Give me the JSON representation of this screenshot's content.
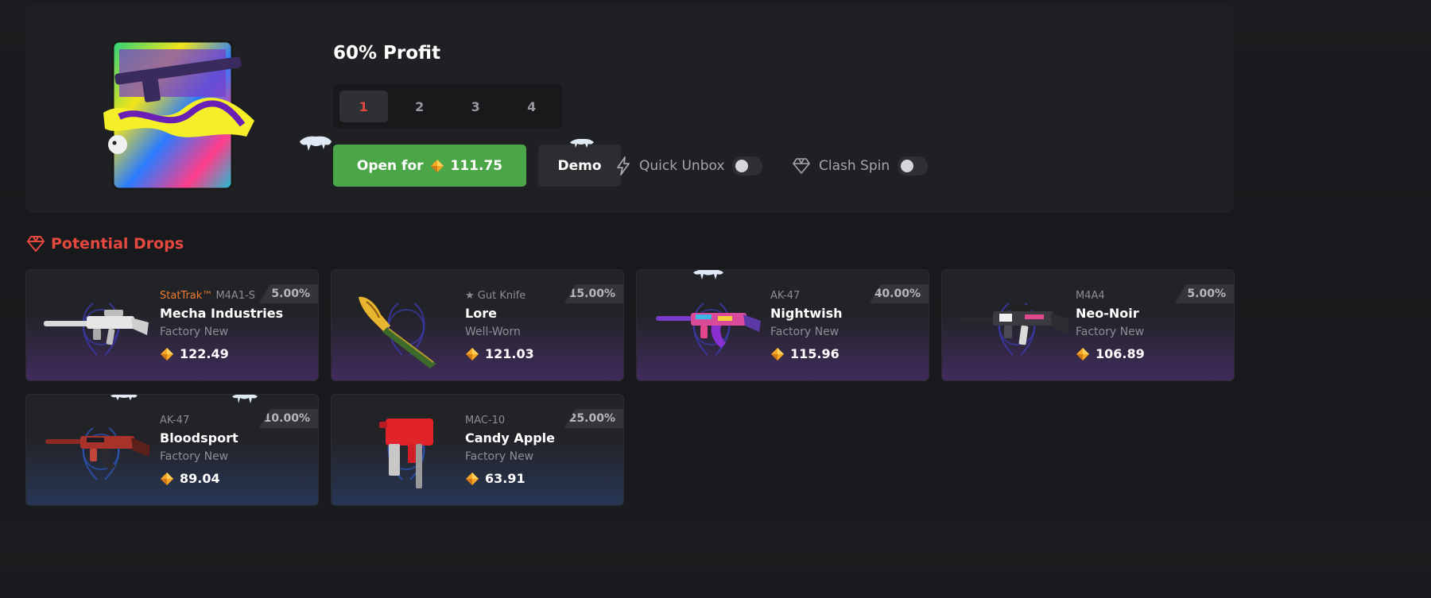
{
  "case": {
    "title": "60% Profit",
    "counts": [
      "1",
      "2",
      "3",
      "4"
    ],
    "selected_count": "1",
    "open_label": "Open for",
    "open_price": "111.75",
    "demo_label": "Demo"
  },
  "toggles": {
    "quick_unbox": {
      "label": "Quick Unbox",
      "enabled": false
    },
    "clash_spin": {
      "label": "Clash Spin",
      "enabled": false
    }
  },
  "drops_section": {
    "title": "Potential Drops"
  },
  "drops": [
    {
      "stattrak": "StatTrak™",
      "weapon": "M4A1-S",
      "name": "Mecha Industries",
      "condition": "Factory New",
      "price": "122.49",
      "chance": "5.00%",
      "rarity_color": "purple"
    },
    {
      "stattrak": "",
      "weapon": "★ Gut Knife",
      "name": "Lore",
      "condition": "Well-Worn",
      "price": "121.03",
      "chance": "15.00%",
      "rarity_color": "purple"
    },
    {
      "stattrak": "",
      "weapon": "AK-47",
      "name": "Nightwish",
      "condition": "Factory New",
      "price": "115.96",
      "chance": "40.00%",
      "rarity_color": "purple"
    },
    {
      "stattrak": "",
      "weapon": "M4A4",
      "name": "Neo-Noir",
      "condition": "Factory New",
      "price": "106.89",
      "chance": "5.00%",
      "rarity_color": "purple"
    },
    {
      "stattrak": "",
      "weapon": "AK-47",
      "name": "Bloodsport",
      "condition": "Factory New",
      "price": "89.04",
      "chance": "10.00%",
      "rarity_color": "blue"
    },
    {
      "stattrak": "",
      "weapon": "MAC-10",
      "name": "Candy Apple",
      "condition": "Factory New",
      "price": "63.91",
      "chance": "25.00%",
      "rarity_color": "blue"
    }
  ],
  "colors": {
    "accent_red": "#e5483f",
    "open_green": "#4aa647",
    "coin_gold": "#f5a623",
    "stattrak_orange": "#f07d2e"
  }
}
